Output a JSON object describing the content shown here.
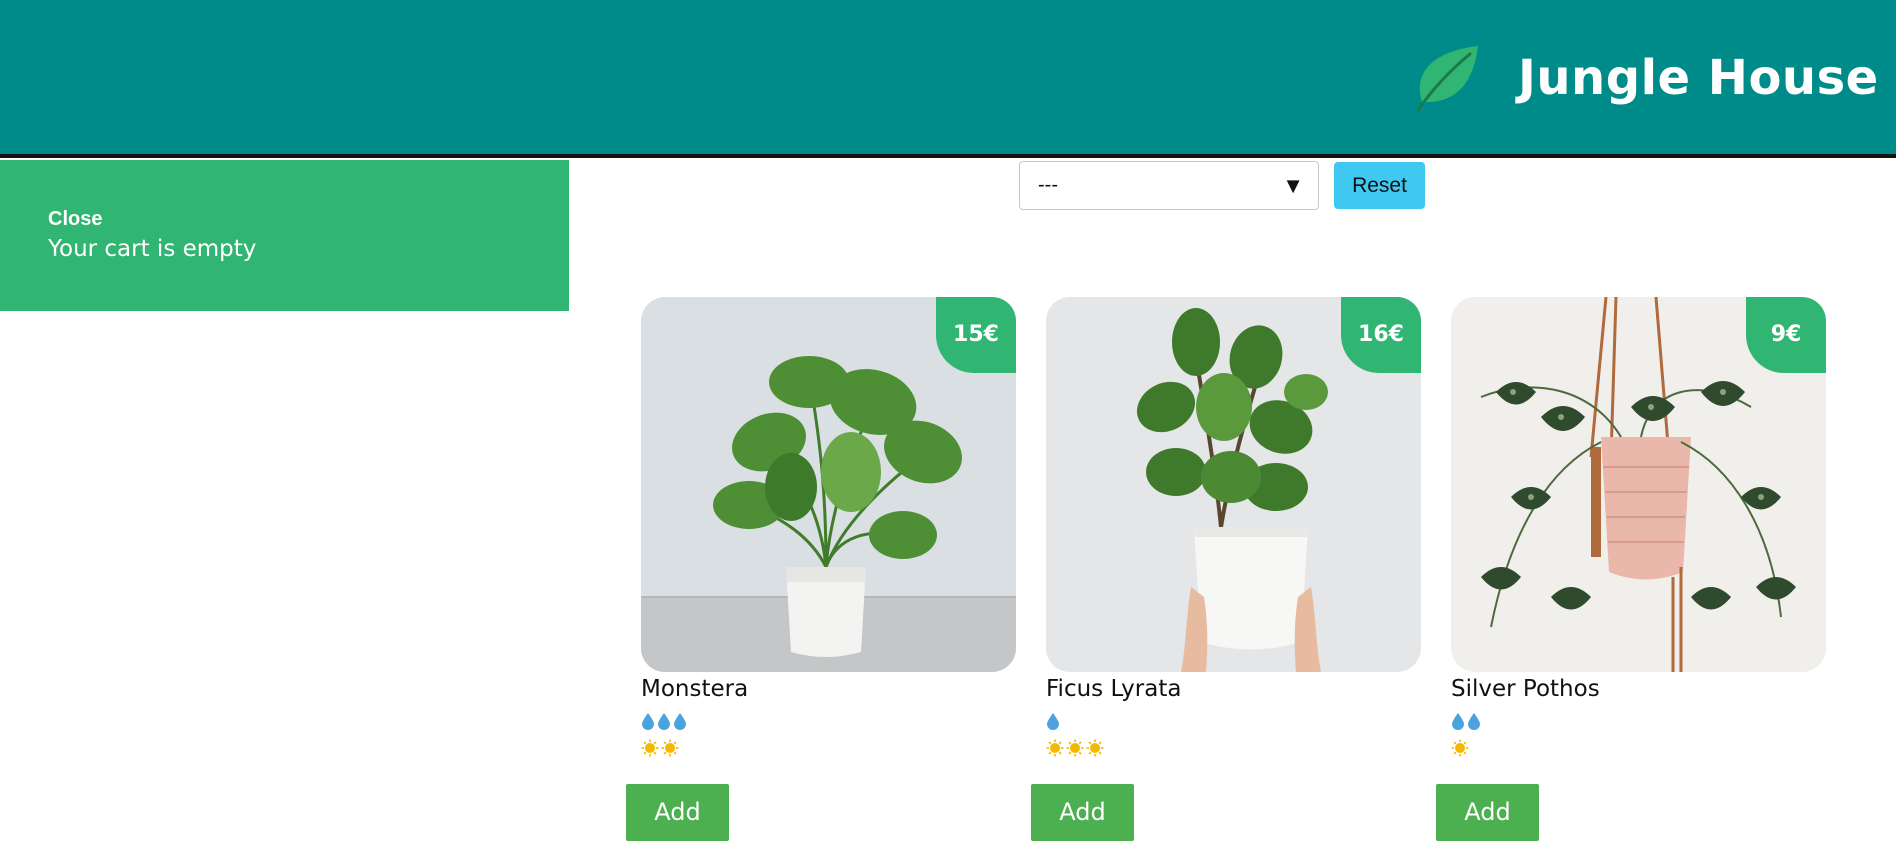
{
  "header": {
    "brand": "Jungle House",
    "logo_icon": "leaf-icon",
    "bg_color": "#008b8b"
  },
  "cart": {
    "close_label": "Close",
    "empty_message": "Your cart is empty",
    "bg_color": "#31b572"
  },
  "filter": {
    "selected": "---",
    "reset_label": "Reset"
  },
  "products": [
    {
      "name": "Monstera",
      "price": "15€",
      "water": 3,
      "light": 2,
      "add_label": "Add"
    },
    {
      "name": "Ficus Lyrata",
      "price": "16€",
      "water": 1,
      "light": 3,
      "add_label": "Add"
    },
    {
      "name": "Silver Pothos",
      "price": "9€",
      "water": 2,
      "light": 1,
      "add_label": "Add"
    }
  ],
  "colors": {
    "accent": "#31b572",
    "reset_button": "#3fc8f0",
    "add_button": "#4caf50",
    "water_drop": "#4aa3df",
    "sun": "#f5b800"
  }
}
